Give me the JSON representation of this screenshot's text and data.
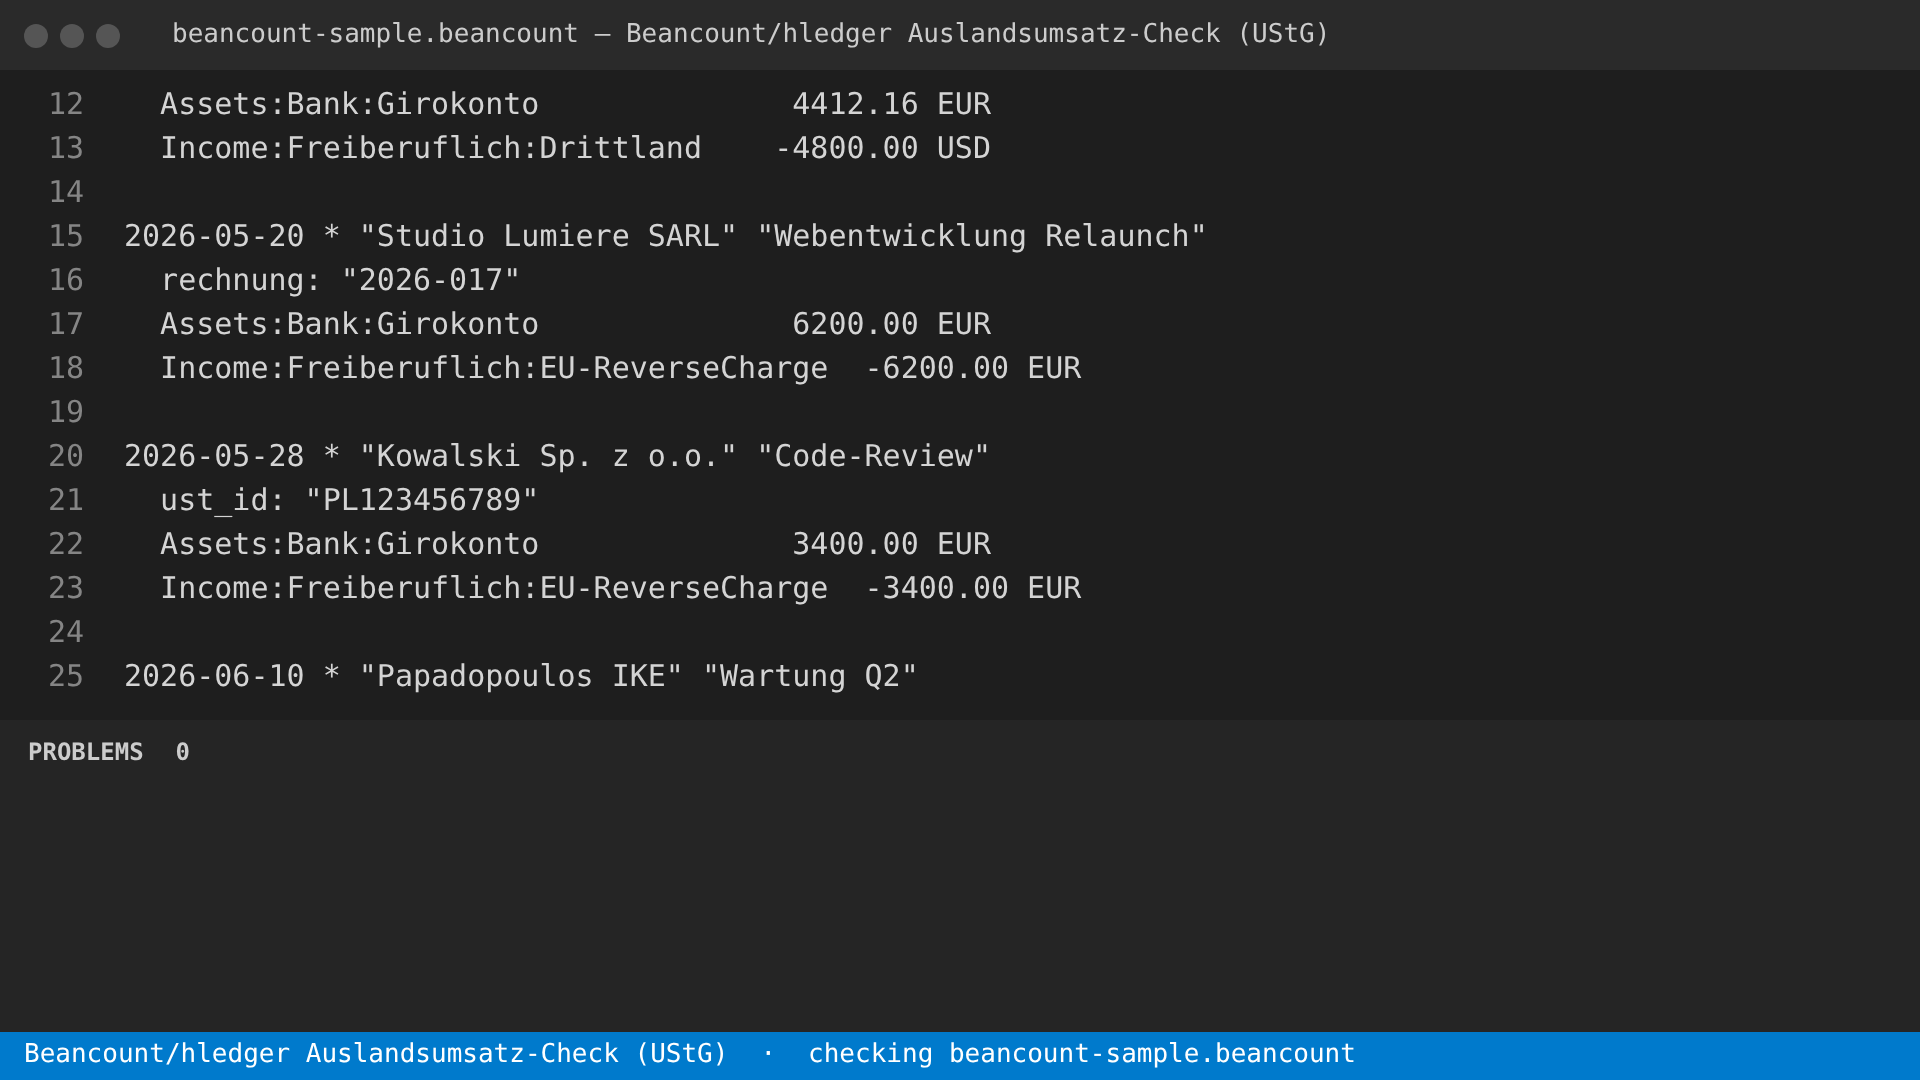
{
  "window": {
    "title": "beancount-sample.beancount — Beancount/hledger Auslandsumsatz-Check (UStG)"
  },
  "editor": {
    "lines": [
      {
        "number": "12",
        "text": "  Assets:Bank:Girokonto              4412.16 EUR"
      },
      {
        "number": "13",
        "text": "  Income:Freiberuflich:Drittland    -4800.00 USD"
      },
      {
        "number": "14"
      },
      {
        "number": "15",
        "text": "2026-05-20 * \"Studio Lumiere SARL\" \"Webentwicklung Relaunch\""
      },
      {
        "number": "16",
        "text": "  rechnung: \"2026-017\""
      },
      {
        "number": "17",
        "text": "  Assets:Bank:Girokonto              6200.00 EUR"
      },
      {
        "number": "18",
        "text": "  Income:Freiberuflich:EU-ReverseCharge  -6200.00 EUR"
      },
      {
        "number": "19"
      },
      {
        "number": "20",
        "text": "2026-05-28 * \"Kowalski Sp. z o.o.\" \"Code-Review\""
      },
      {
        "number": "21",
        "text": "  ust_id: \"PL123456789\""
      },
      {
        "number": "22",
        "text": "  Assets:Bank:Girokonto              3400.00 EUR"
      },
      {
        "number": "23",
        "text": "  Income:Freiberuflich:EU-ReverseCharge  -3400.00 EUR"
      },
      {
        "number": "24"
      },
      {
        "number": "25",
        "text": "2026-06-10 * \"Papadopoulos IKE\" \"Wartung Q2\""
      }
    ]
  },
  "problems_panel": {
    "title": "PROBLEMS",
    "count": "0"
  },
  "status_bar": {
    "items": [
      "Beancount/hledger Auslandsumsatz-Check (UStG)",
      "·",
      "checking beancount-sample.beancount"
    ]
  }
}
